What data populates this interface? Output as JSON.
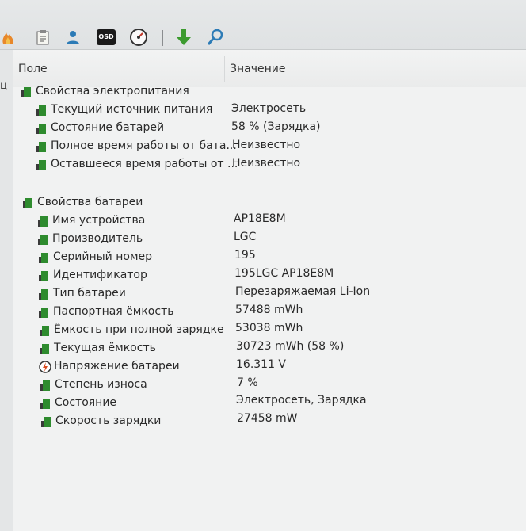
{
  "header": {
    "field": "Поле",
    "value": "Значение"
  },
  "left_strip_text": "ц",
  "toolbar": {
    "icons": [
      "fire-icon",
      "report-icon",
      "user-icon",
      "osd-icon",
      "gauge-icon",
      "download-arrow-icon",
      "search-icon"
    ],
    "osd_label": "OSD"
  },
  "power": {
    "title": "Свойства электропитания",
    "items": [
      {
        "label": "Текущий источник питания",
        "value": "Электросеть"
      },
      {
        "label": "Состояние батарей",
        "value": "58 % (Зарядка)"
      },
      {
        "label": "Полное время работы от бата...",
        "value": "Неизвестно"
      },
      {
        "label": "Оставшееся время работы от ...",
        "value": "Неизвестно"
      }
    ]
  },
  "battery": {
    "title": "Свойства батареи",
    "items": [
      {
        "label": "Имя устройства",
        "value": "AP18E8M"
      },
      {
        "label": "Производитель",
        "value": "LGC"
      },
      {
        "label": "Серийный номер",
        "value": "195"
      },
      {
        "label": "Идентификатор",
        "value": "195LGC AP18E8M"
      },
      {
        "label": "Тип батареи",
        "value": "Перезаряжаемая Li-Ion"
      },
      {
        "label": "Паспортная ёмкость",
        "value": "57488 mWh"
      },
      {
        "label": "Ёмкость при полной зарядке",
        "value": "53038 mWh"
      },
      {
        "label": "Текущая ёмкость",
        "value": "30723 mWh  (58 %)"
      },
      {
        "label": "Напряжение батареи",
        "value": "16.311 V"
      },
      {
        "label": "Степень износа",
        "value": "7 %"
      },
      {
        "label": "Состояние",
        "value": "Электросеть, Зарядка"
      },
      {
        "label": "Скорость зарядки",
        "value": "27458 mW"
      }
    ]
  },
  "colors": {
    "battery_green": "#2e8b2e",
    "battery_dark": "#3a3a3a",
    "toolbar_green": "#3c9b2f"
  }
}
